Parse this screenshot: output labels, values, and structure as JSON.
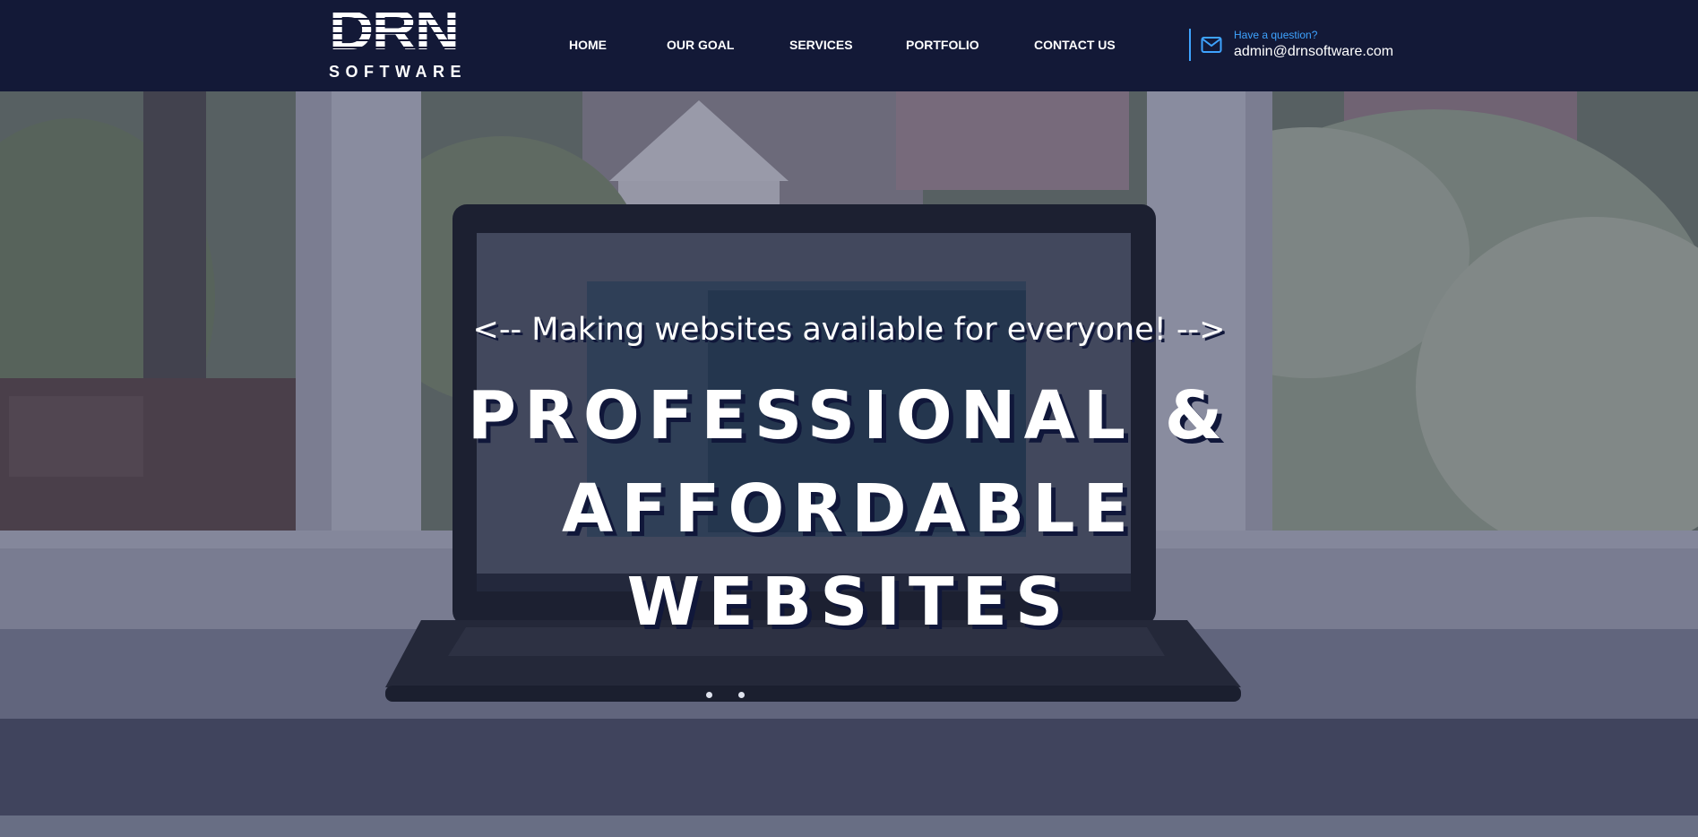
{
  "brand": {
    "logo_main": "DRN",
    "logo_sub": "SOFTWARE"
  },
  "nav": {
    "items": [
      {
        "label": "HOME"
      },
      {
        "label": "OUR GOAL"
      },
      {
        "label": "SERVICES"
      },
      {
        "label": "PORTFOLIO"
      },
      {
        "label": "CONTACT US"
      }
    ]
  },
  "contact": {
    "icon": "mail-icon",
    "label": "Have a question?",
    "email": "admin@drnsoftware.com"
  },
  "hero": {
    "tagline": "<-- Making websites available for everyone! -->",
    "title_line1": "PROFESSIONAL & AFFORDABLE",
    "title_line2": "WEBSITES",
    "slides": 2,
    "active_slide": 1
  },
  "colors": {
    "header_bg": "#131937",
    "accent": "#3ea3ff",
    "text": "#ffffff"
  }
}
